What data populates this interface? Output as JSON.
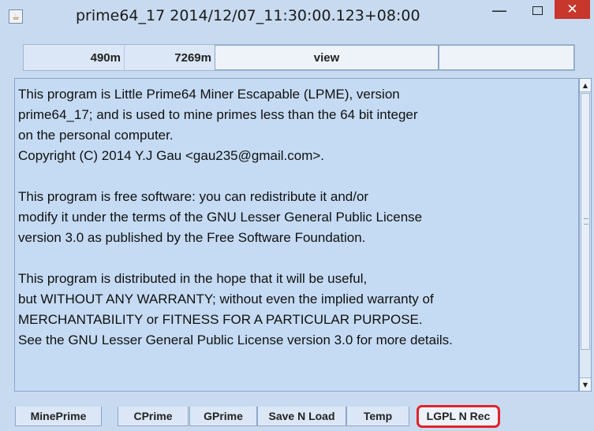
{
  "window": {
    "title": "prime64_17   2014/12/07_11:30:00.123+08:00",
    "minimize_glyph": "—",
    "close_glyph": "✕"
  },
  "header": {
    "cell_a": "490m",
    "cell_b": "7269m",
    "view_label": "view",
    "empty_label": ""
  },
  "content": {
    "lines": [
      "This program is Little Prime64 Miner Escapable (LPME), version",
      "prime64_17; and is used to mine primes less than the 64 bit integer",
      "on the personal computer.",
      "Copyright (C) 2014 Y.J Gau <gau235@gmail.com>.",
      "",
      "This program is free software: you can redistribute it and/or",
      "modify it under the terms of the GNU Lesser General Public License",
      "version 3.0 as published by the Free Software Foundation.",
      "",
      "This program is distributed in the hope that it will be useful,",
      "but WITHOUT ANY WARRANTY; without even the implied warranty of",
      "MERCHANTABILITY or FITNESS FOR A PARTICULAR PURPOSE.",
      "See the GNU Lesser General Public License version 3.0 for more details."
    ]
  },
  "tabs": [
    {
      "label": "MinePrime",
      "selected": false
    },
    {
      "label": "CPrime",
      "selected": false
    },
    {
      "label": "GPrime",
      "selected": false
    },
    {
      "label": "Save N Load",
      "selected": false
    },
    {
      "label": "Temp",
      "selected": false
    },
    {
      "label": "LGPL N Rec",
      "selected": true
    }
  ],
  "colors": {
    "highlight_outline": "#e0232b",
    "close_button": "#c7372c",
    "background": "#c8daf0"
  }
}
